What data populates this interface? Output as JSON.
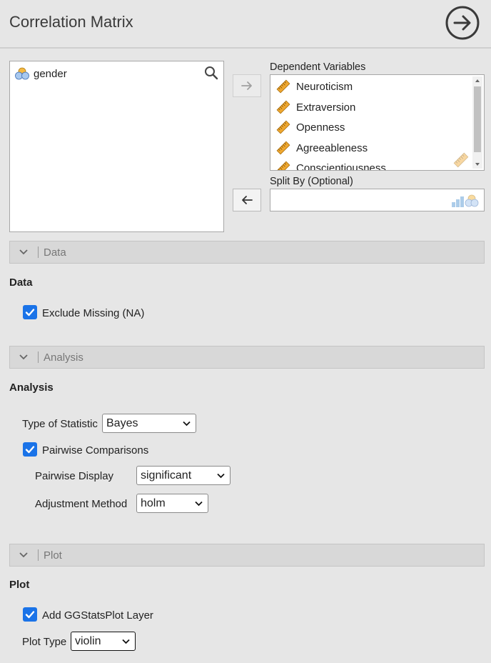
{
  "header": {
    "title": "Correlation Matrix"
  },
  "variables": {
    "items": [
      {
        "label": "gender",
        "icon": "nominal-variable-icon"
      }
    ]
  },
  "dependent": {
    "label": "Dependent Variables",
    "items": [
      {
        "label": "Neuroticism",
        "icon": "continuous-variable-icon"
      },
      {
        "label": "Extraversion",
        "icon": "continuous-variable-icon"
      },
      {
        "label": "Openness",
        "icon": "continuous-variable-icon"
      },
      {
        "label": "Agreeableness",
        "icon": "continuous-variable-icon"
      },
      {
        "label": "Conscientiousness",
        "icon": "continuous-variable-icon"
      }
    ]
  },
  "split": {
    "label": "Split By (Optional)"
  },
  "sections": {
    "data": {
      "header": "Data",
      "title": "Data",
      "exclude_missing": {
        "label": "Exclude Missing (NA)",
        "checked": true
      }
    },
    "analysis": {
      "header": "Analysis",
      "title": "Analysis",
      "type_of_statistic": {
        "label": "Type of Statistic",
        "value": "Bayes"
      },
      "pairwise": {
        "label": "Pairwise Comparisons",
        "checked": true
      },
      "pairwise_display": {
        "label": "Pairwise Display",
        "value": "significant"
      },
      "adjustment": {
        "label": "Adjustment Method",
        "value": "holm"
      }
    },
    "plot": {
      "header": "Plot",
      "title": "Plot",
      "add_layer": {
        "label": "Add GGStatsPlot Layer",
        "checked": true
      },
      "plot_type": {
        "label": "Plot Type",
        "value": "violin"
      }
    }
  },
  "colors": {
    "accent": "#1a73e8",
    "ruler": "#f0a830",
    "nominal_blue": "#5b9bd5",
    "nominal_orange": "#f5b942"
  }
}
